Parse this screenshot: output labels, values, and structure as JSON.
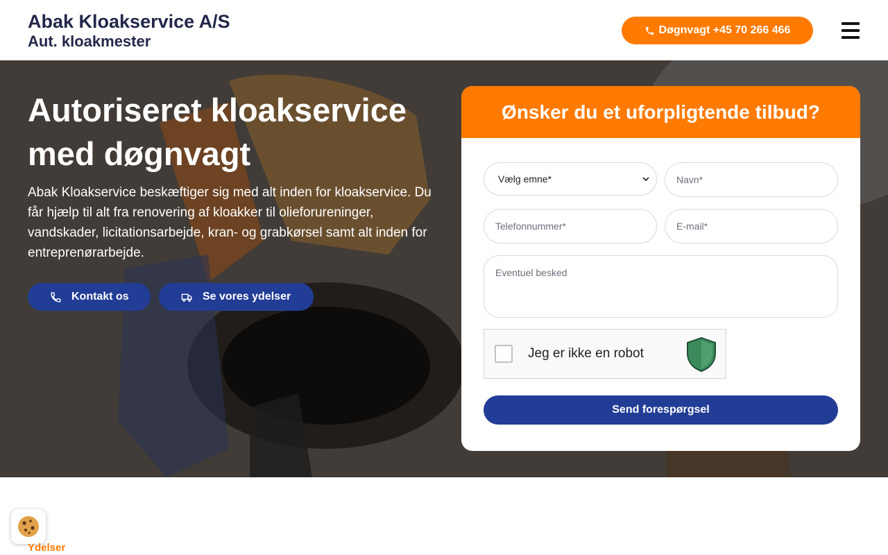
{
  "header": {
    "brand_name": "Abak Kloakservice A/S",
    "brand_sub": "Aut. kloakmester",
    "phone_label": "Døgnvagt +45 70 266 466",
    "menu_icon": "hamburger-menu-icon"
  },
  "hero": {
    "title": "Autoriseret kloakservice med døgnvagt",
    "text": "Abak Kloakservice beskæftiger sig med alt inden for kloakservice. Du får hjælp til alt fra renovering af kloakker til olieforureninger, vandskader, licitationsarbejde, kran- og grabkørsel samt alt inden for entreprenørarbejde.",
    "buttons": {
      "contact": "Kontakt os",
      "services": "Se vores ydelser"
    }
  },
  "form": {
    "heading": "Ønsker du et uforpligtende tilbud?",
    "select_value": "Vælg emne*",
    "name_placeholder": "Navn*",
    "phone_placeholder": "Telefonnummer*",
    "email_placeholder": "E-mail*",
    "message_placeholder": "Eventuel besked",
    "captcha_label": "Jeg er ikke en robot",
    "submit_label": "Send forespørgsel"
  },
  "section": {
    "label": "Ydelser"
  },
  "colors": {
    "accent": "#ff7a00",
    "primary": "#223d96",
    "text_dark": "#23284a"
  }
}
